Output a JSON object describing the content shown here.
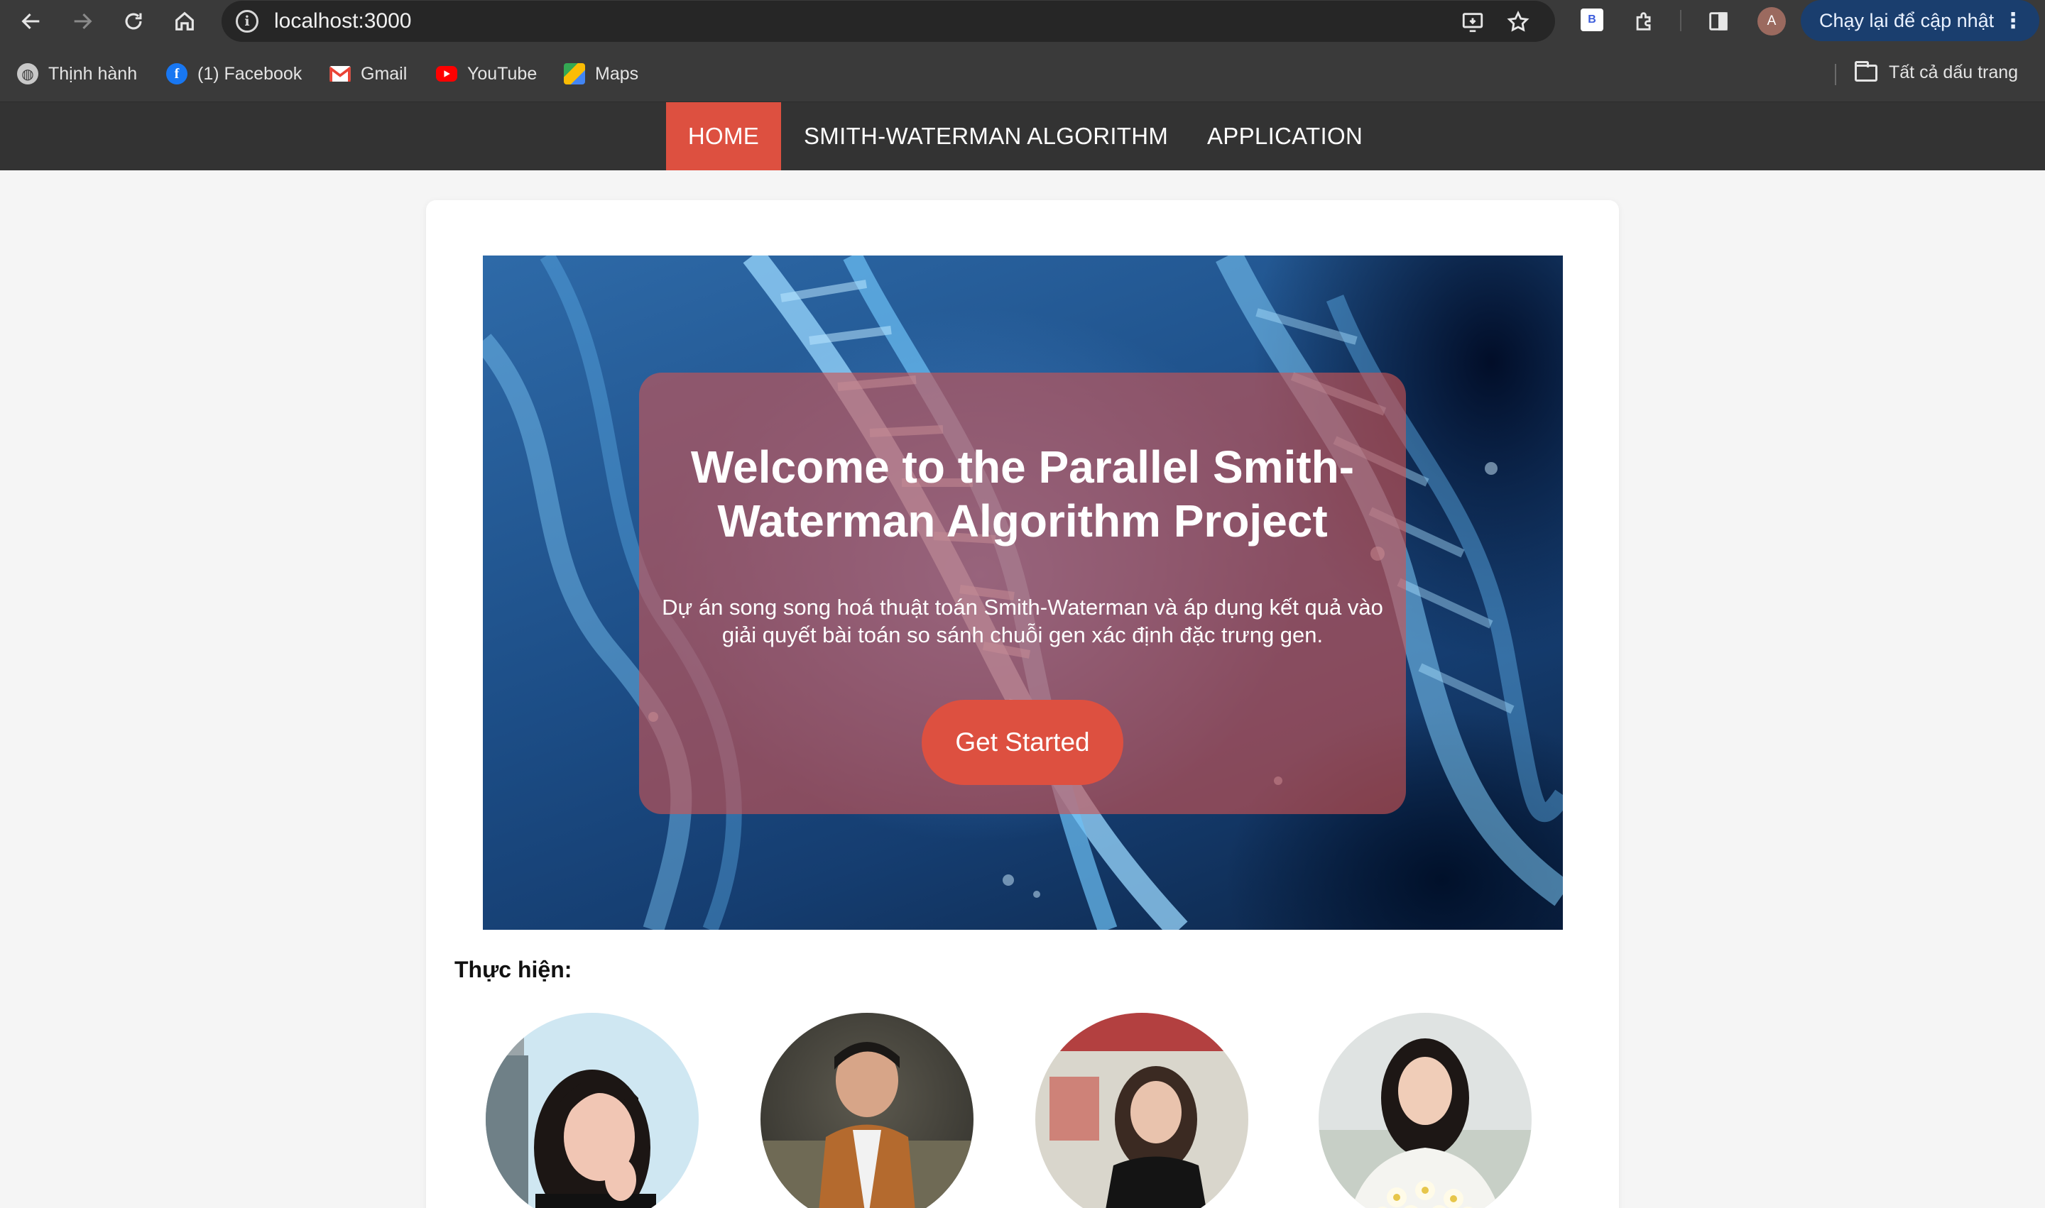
{
  "browser": {
    "url": "localhost:3000",
    "update_button": "Chạy lại để cập nhật",
    "profile_initial": "A",
    "extension_label": "B",
    "bookmarks": [
      {
        "label": "Thịnh hành",
        "icon": "globe-icon"
      },
      {
        "label": "(1) Facebook",
        "icon": "facebook-icon"
      },
      {
        "label": "Gmail",
        "icon": "gmail-icon"
      },
      {
        "label": "YouTube",
        "icon": "youtube-icon"
      },
      {
        "label": "Maps",
        "icon": "maps-icon"
      }
    ],
    "all_bookmarks": "Tất cả dấu trang"
  },
  "nav": {
    "items": [
      {
        "label": "HOME",
        "active": true
      },
      {
        "label": "SMITH-WATERMAN ALGORITHM",
        "active": false
      },
      {
        "label": "APPLICATION",
        "active": false
      }
    ]
  },
  "hero": {
    "title": "Welcome to the Parallel Smith-Waterman Algorithm Project",
    "subtitle": "Dự án song song hoá thuật toán Smith-Waterman và áp dụng kết quả vào giải quyết bài toán so sánh chuỗi gen xác định đặc trưng gen.",
    "cta_label": "Get Started"
  },
  "team": {
    "label": "Thực hiện:"
  },
  "colors": {
    "accent": "#dd5040",
    "nav_bg": "#333333",
    "chrome_bg": "#3a3a3a",
    "update_btn": "#1a3e6e"
  }
}
